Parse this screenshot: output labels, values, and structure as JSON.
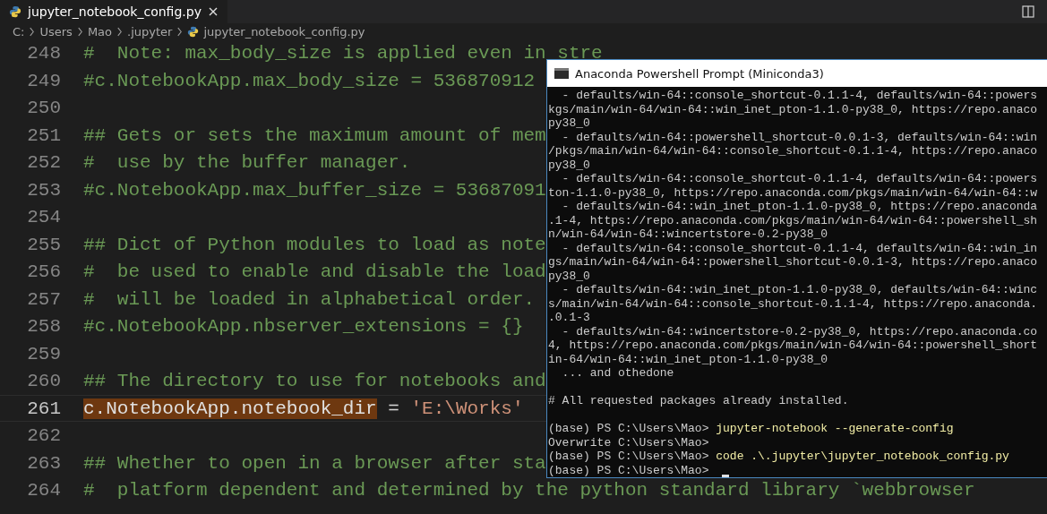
{
  "editor_tab": {
    "label": "jupyter_notebook_config.py",
    "selected": true
  },
  "breadcrumb": [
    {
      "label": "C:",
      "kind": "folder"
    },
    {
      "label": "Users",
      "kind": "folder"
    },
    {
      "label": "Mao",
      "kind": "folder"
    },
    {
      "label": ".jupyter",
      "kind": "folder"
    },
    {
      "label": "jupyter_notebook_config.py",
      "kind": "file"
    }
  ],
  "code_lines": [
    {
      "number": "248",
      "current": false,
      "segments": [
        {
          "text": "#  Note: max_body_size is applied even in stre",
          "kind": "comment"
        }
      ]
    },
    {
      "number": "249",
      "current": false,
      "segments": [
        {
          "text": "#c.NotebookApp.max_body_size = 536870912",
          "kind": "comment"
        }
      ]
    },
    {
      "number": "250",
      "current": false
    },
    {
      "number": "251",
      "current": false,
      "segments": [
        {
          "text": "## Gets or sets the maximum amount of mem",
          "kind": "comment"
        }
      ]
    },
    {
      "number": "252",
      "current": false,
      "segments": [
        {
          "text": "#  use by the buffer manager.",
          "kind": "comment"
        }
      ]
    },
    {
      "number": "253",
      "current": false,
      "segments": [
        {
          "text": "#c.NotebookApp.max_buffer_size = 53687091",
          "kind": "comment"
        }
      ]
    },
    {
      "number": "254",
      "current": false
    },
    {
      "number": "255",
      "current": false,
      "segments": [
        {
          "text": "## Dict of Python modules to load as note",
          "kind": "comment"
        }
      ]
    },
    {
      "number": "256",
      "current": false,
      "segments": [
        {
          "text": "#  be used to enable and disable the load",
          "kind": "comment"
        }
      ]
    },
    {
      "number": "257",
      "current": false,
      "segments": [
        {
          "text": "#  will be loaded in alphabetical order.",
          "kind": "comment"
        }
      ]
    },
    {
      "number": "258",
      "current": false,
      "segments": [
        {
          "text": "#c.NotebookApp.nbserver_extensions = {}",
          "kind": "comment"
        }
      ]
    },
    {
      "number": "259",
      "current": false
    },
    {
      "number": "260",
      "current": false,
      "segments": [
        {
          "text": "## The directory to use for notebooks and",
          "kind": "comment"
        }
      ]
    },
    {
      "number": "261",
      "current": true,
      "segments": [
        {
          "text": "c.NotebookApp.notebook_dir",
          "kind": "highlight"
        },
        {
          "text": " = ",
          "kind": "plain"
        },
        {
          "text": "'E:\\Works'",
          "kind": "string"
        }
      ]
    },
    {
      "number": "262",
      "current": false
    },
    {
      "number": "263",
      "current": false,
      "segments": [
        {
          "text": "## Whether to open in a browser after sta",
          "kind": "comment"
        }
      ]
    },
    {
      "number": "264",
      "current": false,
      "segments": [
        {
          "text": "#  platform dependent and determined by the python standard library `webbrowser",
          "kind": "comment"
        }
      ]
    }
  ],
  "console": {
    "title": "Anaconda Powershell Prompt (Miniconda3)",
    "cursor": true,
    "lines": [
      {
        "segments": [
          {
            "text": "  - defaults/win-64::console_shortcut-0.1.1-4, defaults/win-64::powers",
            "kind": "output"
          }
        ]
      },
      {
        "segments": [
          {
            "text": "kgs/main/win-64/win-64::win_inet_pton-1.1.0-py38_0, https://repo.anaco",
            "kind": "output"
          }
        ]
      },
      {
        "segments": [
          {
            "text": "py38_0",
            "kind": "output"
          }
        ]
      },
      {
        "segments": [
          {
            "text": "  - defaults/win-64::powershell_shortcut-0.0.1-3, defaults/win-64::win",
            "kind": "output"
          }
        ]
      },
      {
        "segments": [
          {
            "text": "/pkgs/main/win-64/win-64::console_shortcut-0.1.1-4, https://repo.anaco",
            "kind": "output"
          }
        ]
      },
      {
        "segments": [
          {
            "text": "py38_0",
            "kind": "output"
          }
        ]
      },
      {
        "segments": [
          {
            "text": "  - defaults/win-64::console_shortcut-0.1.1-4, defaults/win-64::powers",
            "kind": "output"
          }
        ]
      },
      {
        "segments": [
          {
            "text": "ton-1.1.0-py38_0, https://repo.anaconda.com/pkgs/main/win-64/win-64::w",
            "kind": "output"
          }
        ]
      },
      {
        "segments": [
          {
            "text": "  - defaults/win-64::win_inet_pton-1.1.0-py38_0, https://repo.anaconda",
            "kind": "output"
          }
        ]
      },
      {
        "segments": [
          {
            "text": ".1-4, https://repo.anaconda.com/pkgs/main/win-64/win-64::powershell_sh",
            "kind": "output"
          }
        ]
      },
      {
        "segments": [
          {
            "text": "n/win-64/win-64::wincertstore-0.2-py38_0",
            "kind": "output"
          }
        ]
      },
      {
        "segments": [
          {
            "text": "  - defaults/win-64::console_shortcut-0.1.1-4, defaults/win-64::win_in",
            "kind": "output"
          }
        ]
      },
      {
        "segments": [
          {
            "text": "gs/main/win-64/win-64::powershell_shortcut-0.0.1-3, https://repo.anaco",
            "kind": "output"
          }
        ]
      },
      {
        "segments": [
          {
            "text": "py38_0",
            "kind": "output"
          }
        ]
      },
      {
        "segments": [
          {
            "text": "  - defaults/win-64::win_inet_pton-1.1.0-py38_0, defaults/win-64::winc",
            "kind": "output"
          }
        ]
      },
      {
        "segments": [
          {
            "text": "s/main/win-64/win-64::console_shortcut-0.1.1-4, https://repo.anaconda.",
            "kind": "output"
          }
        ]
      },
      {
        "segments": [
          {
            "text": ".0.1-3",
            "kind": "output"
          }
        ]
      },
      {
        "segments": [
          {
            "text": "  - defaults/win-64::wincertstore-0.2-py38_0, https://repo.anaconda.co",
            "kind": "output"
          }
        ]
      },
      {
        "segments": [
          {
            "text": "4, https://repo.anaconda.com/pkgs/main/win-64/win-64::powershell_short",
            "kind": "output"
          }
        ]
      },
      {
        "segments": [
          {
            "text": "in-64/win-64::win_inet_pton-1.1.0-py38_0",
            "kind": "output"
          }
        ]
      },
      {
        "segments": [
          {
            "text": "  ... and othedone",
            "kind": "output"
          }
        ]
      },
      {
        "kind": "blank"
      },
      {
        "segments": [
          {
            "text": "# All requested packages already installed.",
            "kind": "output"
          }
        ]
      },
      {
        "kind": "blank"
      },
      {
        "segments": [
          {
            "text": "(base) PS C:\\Users\\Mao> ",
            "kind": "output"
          },
          {
            "text": "jupyter-notebook --generate-config",
            "kind": "command"
          }
        ]
      },
      {
        "segments": [
          {
            "text": "Overwrite C:\\Users\\Mao>",
            "kind": "output"
          }
        ]
      },
      {
        "segments": [
          {
            "text": "(base) PS C:\\Users\\Mao> ",
            "kind": "output"
          },
          {
            "text": "code .\\.jupyter\\jupyter_notebook_config.py",
            "kind": "command"
          }
        ]
      },
      {
        "segments": [
          {
            "text": "(base) PS C:\\Users\\Mao> ",
            "kind": "output"
          }
        ]
      }
    ]
  }
}
